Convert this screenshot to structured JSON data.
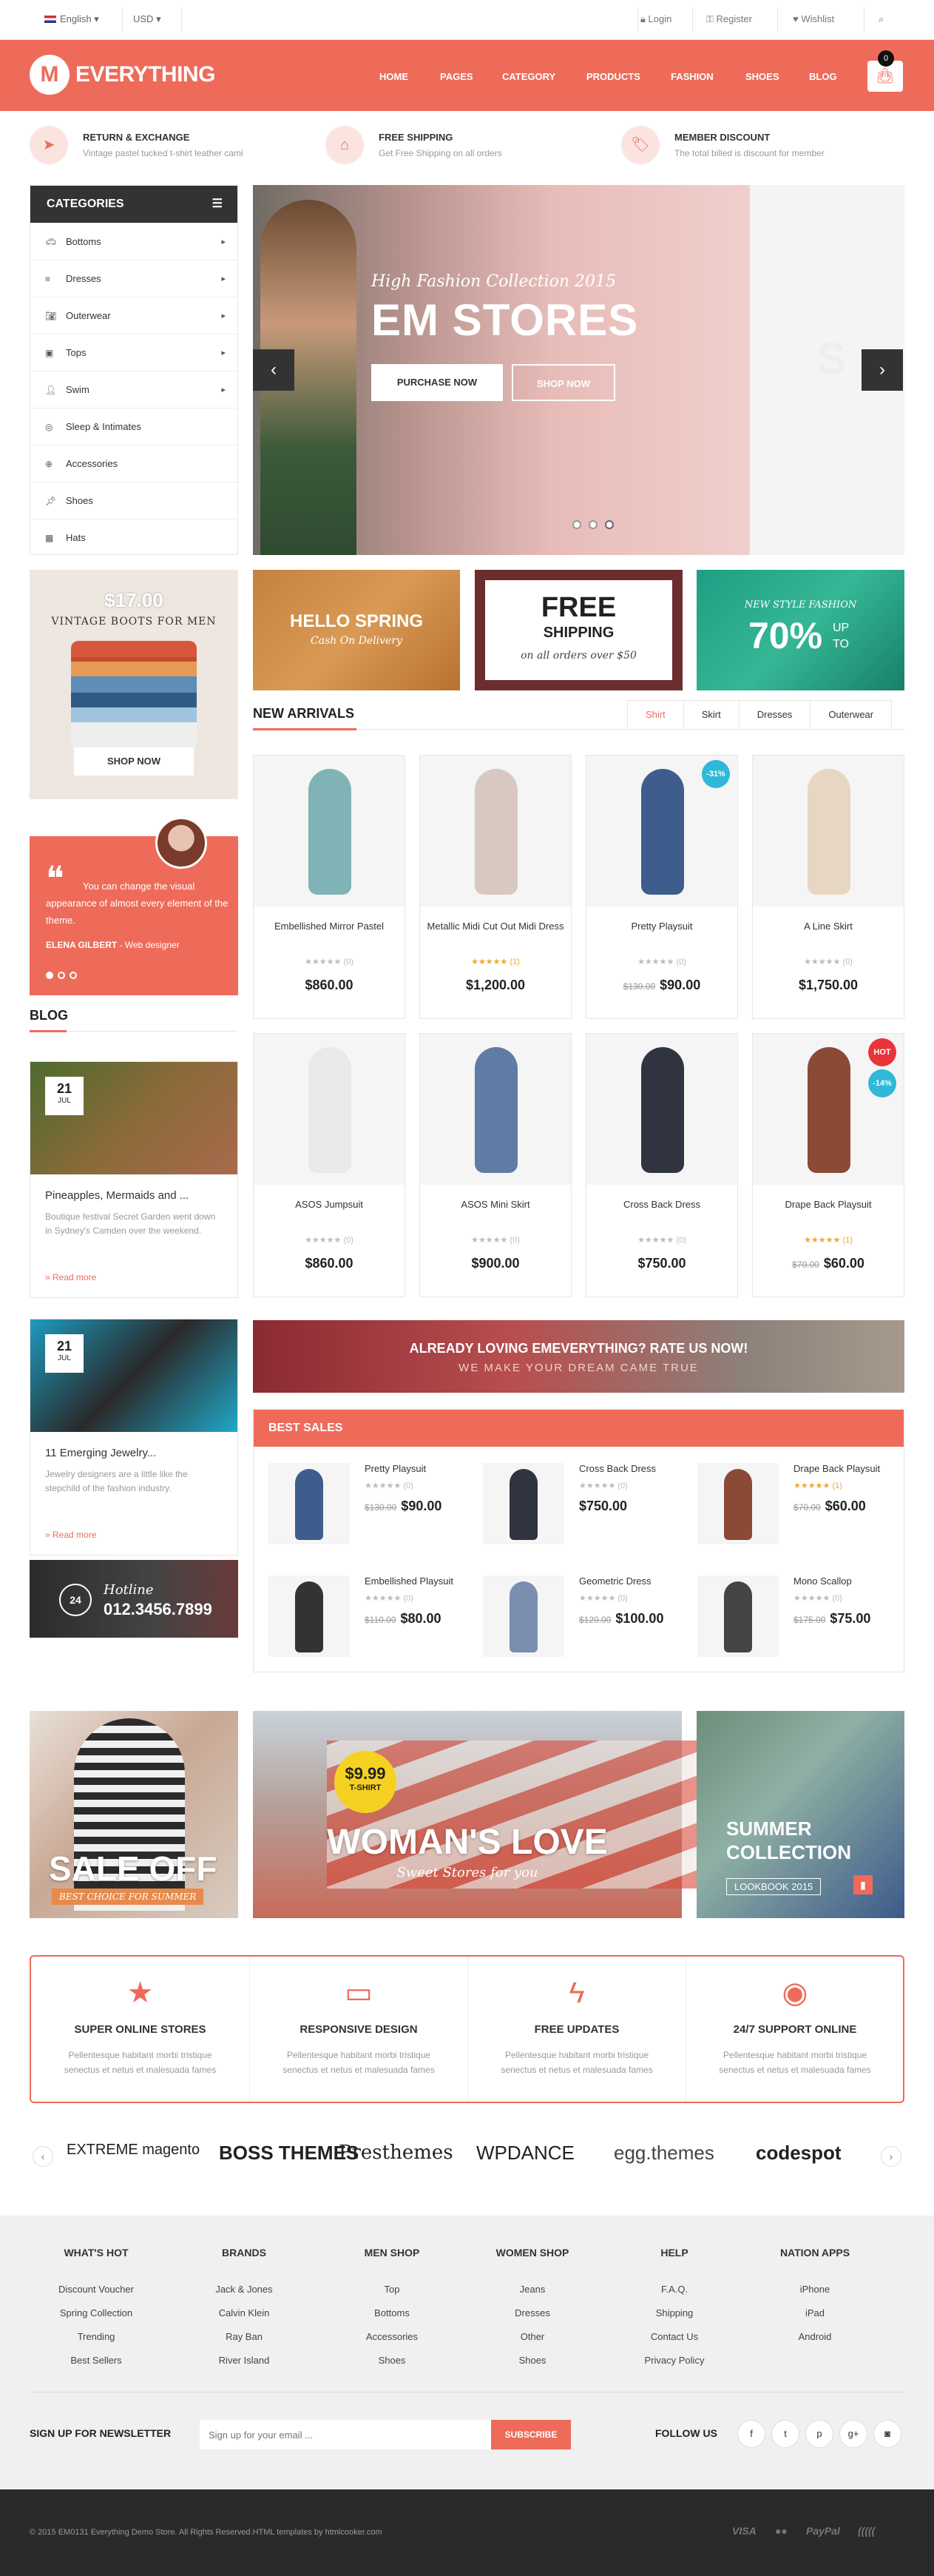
{
  "topbar": {
    "language": "English",
    "currency": "USD",
    "login": "Login",
    "register": "Register",
    "wishlist": "Wishlist"
  },
  "header": {
    "logo_mark": "M",
    "logo_text": "EVERYTHING",
    "nav": [
      "HOME",
      "PAGES",
      "CATEGORY",
      "PRODUCTS",
      "FASHION",
      "SHOES",
      "BLOG"
    ],
    "cart_count": "0",
    "accent": "#ee6b5a"
  },
  "features": [
    {
      "title": "RETURN & EXCHANGE",
      "desc": "Vintage pastel tucked t-shirt leather cami",
      "icon": "paper-plane-icon"
    },
    {
      "title": "FREE SHIPPING",
      "desc": "Get Free Shipping on all orders",
      "icon": "home-icon"
    },
    {
      "title": "MEMBER DISCOUNT",
      "desc": "The total billed is discount for member",
      "icon": "tag-icon"
    }
  ],
  "categories": {
    "title": "CATEGORIES",
    "items": [
      {
        "label": "Bottoms",
        "icon": "car-icon",
        "sub": true
      },
      {
        "label": "Dresses",
        "icon": "bars-icon",
        "sub": true
      },
      {
        "label": "Outerwear",
        "icon": "camera-icon",
        "sub": true
      },
      {
        "label": "Tops",
        "icon": "image-icon",
        "sub": true
      },
      {
        "label": "Swim",
        "icon": "user-icon",
        "sub": true
      },
      {
        "label": "Sleep & Intimates",
        "icon": "compass-icon",
        "sub": false
      },
      {
        "label": "Accessories",
        "icon": "globe-icon",
        "sub": false
      },
      {
        "label": "Shoes",
        "icon": "pin-icon",
        "sub": false
      },
      {
        "label": "Hats",
        "icon": "cube-icon",
        "sub": false
      }
    ]
  },
  "slider": {
    "subtitle": "High Fashion Collection 2015",
    "title": "EM STORES",
    "btn_purchase": "PURCHASE NOW",
    "btn_shop": "SHOP NOW",
    "side_text": "S"
  },
  "left_promo": {
    "price": "$17.00",
    "title": "VINTAGE BOOTS FOR MEN",
    "button": "SHOP NOW"
  },
  "testimonial": {
    "text": "You can change the visual appearance of almost every element of the theme.",
    "author": "ELENA GILBERT",
    "role": " - Web designer"
  },
  "promos": {
    "spring_title": "HELLO SPRING",
    "spring_sub": "Cash On Delivery",
    "free_title": "FREE",
    "free_sub": "SHIPPING",
    "free_note": "on all orders over $50",
    "style_sub": "NEW STYLE FASHION",
    "style_pct": "70%",
    "style_up": "UP",
    "style_to": "TO"
  },
  "arrivals": {
    "title": "NEW ARRIVALS",
    "tabs": [
      "Shirt",
      "Skirt",
      "Dresses",
      "Outerwear"
    ],
    "products": [
      {
        "name": "Embellished Mirror Pastel",
        "stars": "★★★★★",
        "reviews": "(0)",
        "price": "$860.00",
        "old": "",
        "color": "#7fb3b5"
      },
      {
        "name": "Metallic Midi Cut Out Midi Dress",
        "stars": "★★★★★",
        "reviews": "(1)",
        "price": "$1,200.00",
        "old": "",
        "color": "#d9c7c1"
      },
      {
        "name": "Pretty Playsuit",
        "stars": "★★★★★",
        "reviews": "(0)",
        "price": "$90.00",
        "old": "$130.00",
        "badge": "-31%",
        "color": "#3f5d8c"
      },
      {
        "name": "A Line Skirt",
        "stars": "★★★★★",
        "reviews": "(0)",
        "price": "$1,750.00",
        "old": "",
        "color": "#e7d6c2"
      },
      {
        "name": "ASOS Jumpsuit",
        "stars": "★★★★★",
        "reviews": "(0)",
        "price": "$860.00",
        "old": "",
        "color": "#e9e9e9"
      },
      {
        "name": "ASOS Mini Skirt",
        "stars": "★★★★★",
        "reviews": "(0)",
        "price": "$900.00",
        "old": "",
        "color": "#5f7da4"
      },
      {
        "name": "Cross Back Dress",
        "stars": "★★★★★",
        "reviews": "(0)",
        "price": "$750.00",
        "old": "",
        "color": "#2f3440"
      },
      {
        "name": "Drape Back Playsuit",
        "stars": "★★★★★",
        "reviews": "(1)",
        "price": "$60.00",
        "old": "$70.00",
        "badge": "HOT",
        "badge2": "-14%",
        "color": "#8a4a36"
      }
    ]
  },
  "strip": {
    "title": "ALREADY LOVING EMEVERYTHING? RATE US NOW!",
    "sub": "WE MAKE YOUR DREAM CAME TRUE"
  },
  "best_sales": {
    "title": "BEST SALES",
    "items": [
      {
        "name": "Pretty Playsuit",
        "stars": "★★★★★",
        "reviews": "(0)",
        "price": "$90.00",
        "old": "$130.00",
        "color": "#3f5d8c"
      },
      {
        "name": "Cross Back Dress",
        "stars": "★★★★★",
        "reviews": "(0)",
        "price": "$750.00",
        "old": "",
        "color": "#2f3440"
      },
      {
        "name": "Drape Back Playsuit",
        "stars": "★★★★★",
        "reviews": "(1)",
        "price": "$60.00",
        "old": "$70.00",
        "color": "#8a4a36"
      },
      {
        "name": "Embellished Playsuit",
        "stars": "★★★★★",
        "reviews": "(0)",
        "price": "$80.00",
        "old": "$110.00",
        "color": "#333"
      },
      {
        "name": "Geometric Dress",
        "stars": "★★★★★",
        "reviews": "(0)",
        "price": "$100.00",
        "old": "$120.00",
        "color": "#7a8fb0"
      },
      {
        "name": "Mono Scallop",
        "stars": "★★★★★",
        "reviews": "(0)",
        "price": "$75.00",
        "old": "$175.00",
        "color": "#444"
      }
    ]
  },
  "blog": {
    "title": "BLOG",
    "posts": [
      {
        "day": "21",
        "month": "JUL",
        "title": "Pineapples, Mermaids and ...",
        "desc": "Boutique festival Secret Garden went down in Sydney's Camden over the weekend.",
        "more": "» Read more"
      },
      {
        "day": "21",
        "month": "JUL",
        "title": "11 Emerging Jewelry...",
        "desc": "Jewelry designers are a little like the stepchild of the fashion industry.",
        "more": "» Read more"
      }
    ]
  },
  "hotline": {
    "label": "Hotline",
    "number": "012.3456.7899"
  },
  "bottom_banners": {
    "sale": "SALE OFF",
    "sale_sub": "BEST CHOICE FOR SUMMER",
    "price": "$9.99",
    "price_sub": "T-SHIRT",
    "love": "WOMAN'S LOVE",
    "love_sub": "Sweet Stores for you",
    "summer": "SUMMER",
    "collection": "COLLECTION",
    "lookbook": "LOOKBOOK 2015"
  },
  "services": [
    {
      "title": "SUPER ONLINE STORES",
      "desc": "Pellentesque habitant morbi tristique senectus et netus et malesuada fames",
      "icon": "star-icon",
      "glyph": "★"
    },
    {
      "title": "RESPONSIVE DESIGN",
      "desc": "Pellentesque habitant morbi tristique senectus et netus et malesuada fames",
      "icon": "monitor-icon",
      "glyph": "▭"
    },
    {
      "title": "FREE UPDATES",
      "desc": "Pellentesque habitant morbi tristique senectus et netus et malesuada fames",
      "icon": "bolt-icon",
      "glyph": "ϟ"
    },
    {
      "title": "24/7 SUPPORT ONLINE",
      "desc": "Pellentesque habitant morbi tristique senectus et netus et malesuada fames",
      "icon": "lifebuoy-icon",
      "glyph": "◉"
    }
  ],
  "brands": [
    "EXTREME magento",
    "BOSS THEMES",
    "Presthemes",
    "WPDANCE",
    "egg.themes",
    "codespot"
  ],
  "footer": {
    "columns": [
      {
        "title": "WHAT'S HOT",
        "links": [
          "Discount Voucher",
          "Spring Collection",
          "Trending",
          "Best Sellers"
        ]
      },
      {
        "title": "BRANDS",
        "links": [
          "Jack & Jones",
          "Calvin Klein",
          "Ray Ban",
          "River Island"
        ]
      },
      {
        "title": "MEN SHOP",
        "links": [
          "Top",
          "Bottoms",
          "Accessories",
          "Shoes"
        ]
      },
      {
        "title": "WOMEN SHOP",
        "links": [
          "Jeans",
          "Dresses",
          "Other",
          "Shoes"
        ]
      },
      {
        "title": "HELP",
        "links": [
          "F.A.Q.",
          "Shipping",
          "Contact Us",
          "Privacy Policy"
        ]
      },
      {
        "title": "NATION APPS",
        "links": [
          "iPhone",
          "iPad",
          "Android"
        ]
      }
    ],
    "newsletter_label": "SIGN UP FOR NEWSLETTER",
    "newsletter_placeholder": "Sign up for your email ...",
    "subscribe": "SUBSCRIBE",
    "follow": "FOLLOW US",
    "social": [
      "f",
      "t",
      "p",
      "g+",
      "◙"
    ]
  },
  "copyright": {
    "text": "© 2015 EM0131 Everything Demo Store. All Rights Reserved.HTML templates by htmlcooker.com",
    "payments": [
      "VISA",
      "●●",
      "PayPal",
      "((((("
    ]
  }
}
